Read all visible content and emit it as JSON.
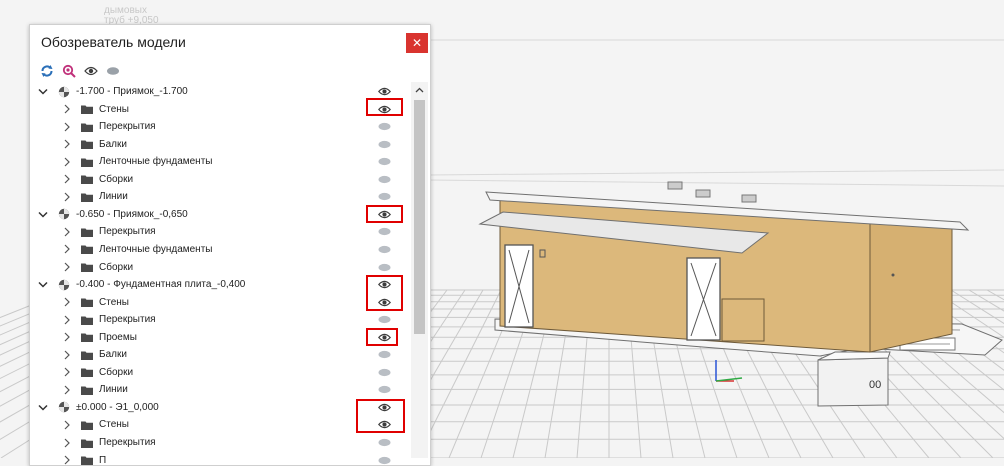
{
  "panel": {
    "title": "Обозреватель модели",
    "close_glyph": "✕",
    "toolbar": [
      {
        "name": "refresh-icon"
      },
      {
        "name": "find-in-model-icon"
      },
      {
        "name": "show-all-eye-icon"
      },
      {
        "name": "hide-all-icon"
      }
    ]
  },
  "tree": {
    "rows": [
      {
        "kind": "level",
        "label": "-1.700 - Приямок_-1.700",
        "visible": true
      },
      {
        "kind": "item",
        "label": "Стены",
        "visible": true
      },
      {
        "kind": "item",
        "label": "Перекрытия",
        "visible": false
      },
      {
        "kind": "item",
        "label": "Балки",
        "visible": false
      },
      {
        "kind": "item",
        "label": "Ленточные фундаменты",
        "visible": false
      },
      {
        "kind": "item",
        "label": "Сборки",
        "visible": false
      },
      {
        "kind": "item",
        "label": "Линии",
        "visible": false
      },
      {
        "kind": "level",
        "label": "-0.650 - Приямок_-0,650",
        "visible": true
      },
      {
        "kind": "item",
        "label": "Перекрытия",
        "visible": false
      },
      {
        "kind": "item",
        "label": "Ленточные фундаменты",
        "visible": false
      },
      {
        "kind": "item",
        "label": "Сборки",
        "visible": false
      },
      {
        "kind": "level",
        "label": "-0.400 - Фундаментная плита_-0,400",
        "visible": true
      },
      {
        "kind": "item",
        "label": "Стены",
        "visible": true
      },
      {
        "kind": "item",
        "label": "Перекрытия",
        "visible": false
      },
      {
        "kind": "item",
        "label": "Проемы",
        "visible": true
      },
      {
        "kind": "item",
        "label": "Балки",
        "visible": false
      },
      {
        "kind": "item",
        "label": "Сборки",
        "visible": false
      },
      {
        "kind": "item",
        "label": "Линии",
        "visible": false
      },
      {
        "kind": "level",
        "label": "±0.000 - Э1_0,000",
        "visible": true
      },
      {
        "kind": "item",
        "label": "Стены",
        "visible": true
      },
      {
        "kind": "item",
        "label": "Перекрытия",
        "visible": false
      },
      {
        "kind": "item",
        "label": "П",
        "visible": false
      }
    ]
  },
  "viewport": {
    "faint_label_1": "дымовых",
    "faint_label_2": "труб +9,050",
    "block_label": "00"
  },
  "colors": {
    "wall": "#dcb87b",
    "wall_side": "#d3ac6e",
    "highlight": "#e00000",
    "close_bg": "#d9342f",
    "eye": "#3d3d3d",
    "hidden_dot": "#b9bec4"
  }
}
